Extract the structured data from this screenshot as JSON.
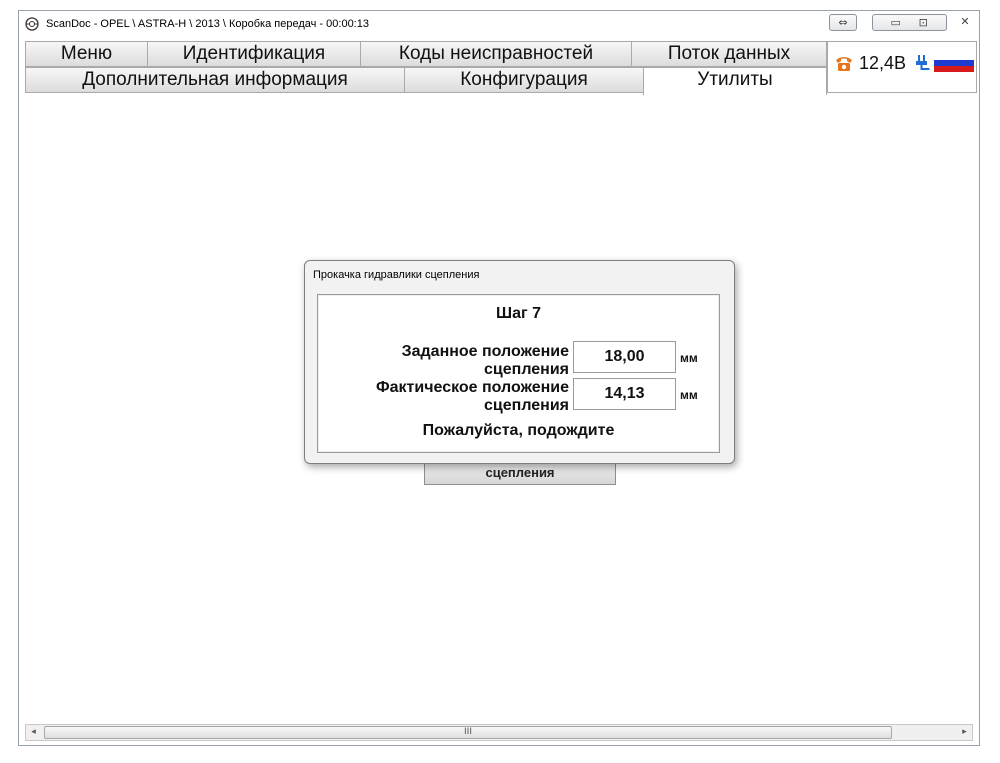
{
  "window": {
    "title": "ScanDoc - OPEL \\ ASTRA-H \\ 2013 \\ Коробка передач - 00:00:13",
    "resize_glyph": "⇔",
    "minimize_glyph": "▭",
    "maximize_glyph": "⊡",
    "close_glyph": "✕"
  },
  "tabs": {
    "row1": [
      "Меню",
      "Идентификация",
      "Коды неисправностей",
      "Поток данных"
    ],
    "row2": [
      "Дополнительная информация",
      "Конфигурация",
      "Утилиты"
    ],
    "active": "Утилиты"
  },
  "status": {
    "voltage": "12,4В",
    "icons": [
      "phone-icon",
      "plug-icon",
      "russian-flag"
    ],
    "colors": {
      "phone": "#e8731a",
      "plug": "#1f6fd1",
      "flag": [
        "#ffffff",
        "#1c3ccf",
        "#d41a1a"
      ]
    }
  },
  "dialog": {
    "title": "Прокачка гидравлики сцепления",
    "step": "Шаг 7",
    "target_label": "Заданное положение сцепления",
    "target_value": "18,00",
    "target_unit": "мм",
    "actual_label": "Фактическое положение сцепления",
    "actual_value": "14,13",
    "actual_unit": "мм",
    "status": "Пожалуйста, подождите"
  },
  "background_button": {
    "label": "сцепления"
  },
  "scrollbar": {
    "left_glyph": "◂",
    "right_glyph": "▸",
    "grip": "III"
  }
}
